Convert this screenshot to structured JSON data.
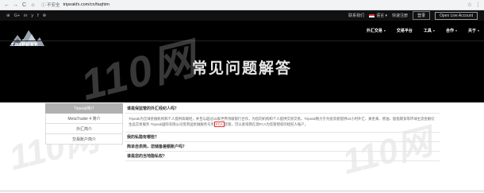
{
  "browser": {
    "back": "←",
    "forward": "→",
    "reload": "C",
    "home": "⌂",
    "security": "ⓘ 不安全",
    "url": "tripeakfx.com/cn/faqhtm",
    "star": "☆",
    "menu": "⋮"
  },
  "topbar": {
    "social": [
      "⊕",
      "G+",
      "in",
      "y",
      "f",
      "⊗"
    ],
    "contact": "联系我们",
    "language": "语言 ▾",
    "registration": "快速注册",
    "login": "登录",
    "open_account": "Open Live Account"
  },
  "header": {
    "logo_text": "TRIPEAK",
    "nav": [
      {
        "label": "外汇交易",
        "chev": "▾"
      },
      {
        "label": "交易平台",
        "chev": ""
      },
      {
        "label": "工具",
        "chev": "▾"
      },
      {
        "label": "合作",
        "chev": "▾"
      },
      {
        "label": "关于",
        "chev": "▾"
      }
    ],
    "page_title": "常见问题解答",
    "watermark": "110网"
  },
  "sidebar": {
    "items": [
      {
        "label": "Tripeak简介",
        "active": true
      },
      {
        "label": "MetaTrader 4 简介",
        "active": false
      },
      {
        "label": "外汇简介",
        "active": false
      },
      {
        "label": "交易账户简介",
        "active": false
      }
    ]
  },
  "faq": {
    "items": [
      {
        "question": "谁是保监管的外汇经纪人吗？"
      },
      {
        "question": "我的私隐有哪些？"
      },
      {
        "question": "简单自表简，您储备差额账户吗？"
      },
      {
        "question": "谁是您的当地隐私权？"
      }
    ],
    "answer_part1": "Tripeak为全球金融机构和个人提供高端经，并且与超过15家世界顶级银行合作，为您的机构和个人提供交易交易。Tripeak致力于为投资者提供24小时外汇、黄金黄、原油、股指期货等环球主流金融衍生品交易服务 Tripeak国际有限公司受英国金融服务号务",
    "answer_highlight": "FCA",
    "answer_part2": "监管，可以查询我在澳FCA为监管授权的经纪人账户。"
  }
}
